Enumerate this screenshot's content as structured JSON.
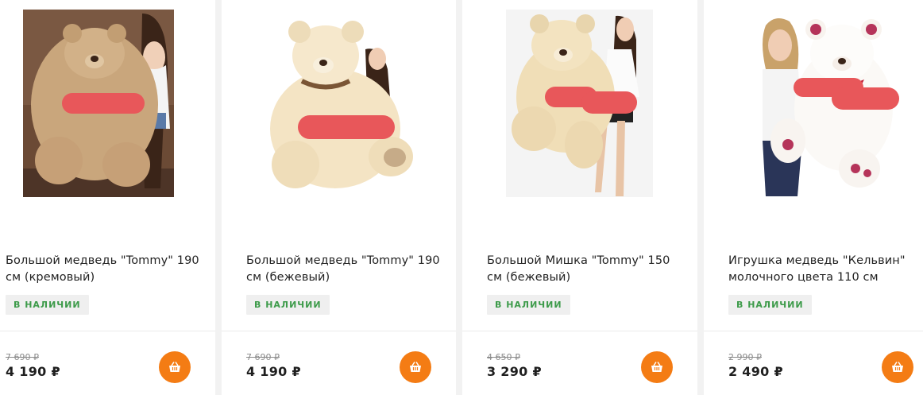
{
  "products": [
    {
      "title": "Большой медведь \"Tommy\" 190 см (кремовый)",
      "stock": "В НАЛИЧИИ",
      "old_price": "7 690 ₽",
      "price": "4 190 ₽"
    },
    {
      "title": "Большой медведь \"Tommy\" 190 см (бежевый)",
      "stock": "В НАЛИЧИИ",
      "old_price": "7 690 ₽",
      "price": "4 190 ₽"
    },
    {
      "title": "Большой Мишка \"Tommy\" 150 см (бежевый)",
      "stock": "В НАЛИЧИИ",
      "old_price": "4 650 ₽",
      "price": "3 290 ₽"
    },
    {
      "title": "Игрушка медведь \"Кельвин\" молочного цвета 110 см",
      "stock": "В НАЛИЧИИ",
      "old_price": "2 990 ₽",
      "price": "2 490 ₽"
    }
  ],
  "colors": {
    "accent": "#f47c14",
    "in_stock": "#3d9b4a",
    "redaction": "#e8575a"
  },
  "icons": {
    "cart": "basket-icon"
  }
}
